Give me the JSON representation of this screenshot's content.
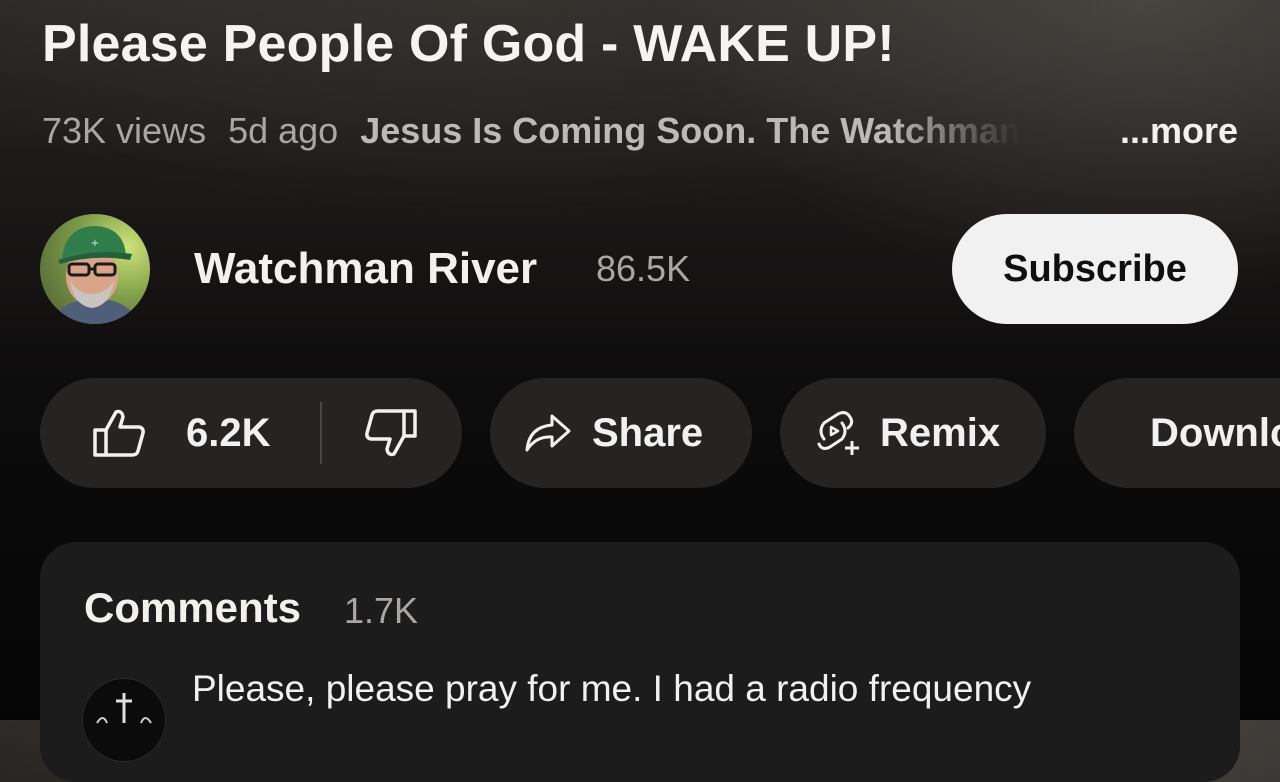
{
  "video": {
    "title": "Please People Of God - WAKE UP!",
    "views": "73K views",
    "age": "5d ago",
    "description_preview": "Jesus Is Coming Soon. The Watchman",
    "more_label": "...more"
  },
  "channel": {
    "name": "Watchman River",
    "subscribers": "86.5K",
    "subscribe_label": "Subscribe",
    "avatar_icon": "channel-avatar"
  },
  "actions": {
    "likes": "6.2K",
    "share_label": "Share",
    "remix_label": "Remix",
    "download_label": "Download"
  },
  "comments": {
    "title": "Comments",
    "count": "1.7K",
    "first_comment": "Please, please pray for me. I had a radio frequency"
  },
  "colors": {
    "subscribe_bg": "#f1f1f1",
    "pill_bg": "#262423",
    "comments_bg": "#1d1c1c"
  }
}
